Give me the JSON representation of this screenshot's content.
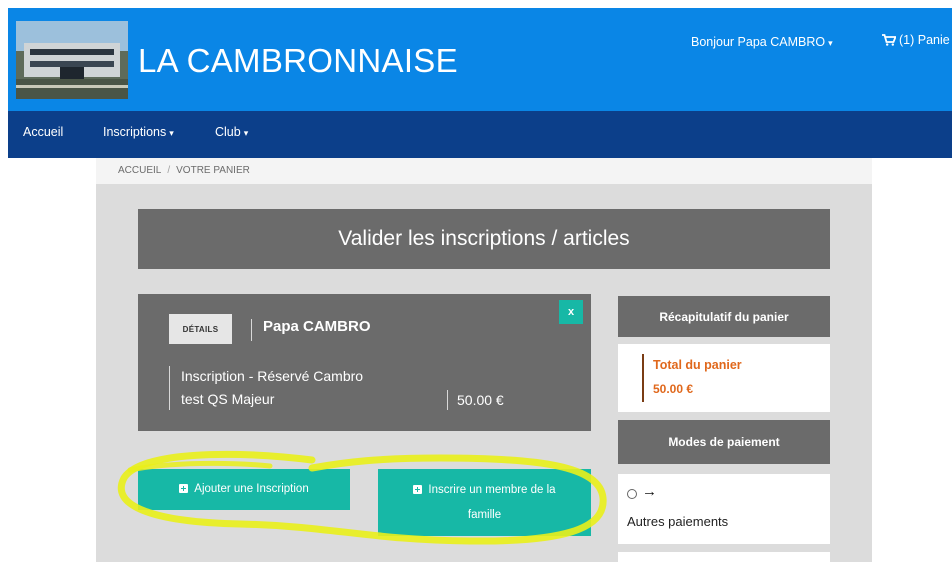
{
  "header": {
    "site_title": "LA CAMBRONNAISE",
    "greeting": "Bonjour Papa CAMBRO",
    "cart_label": "(1) Panie",
    "color_primary": "#0a86e6",
    "color_nav": "#0c3f8a"
  },
  "nav": {
    "items": [
      {
        "label": "Accueil"
      },
      {
        "label": "Inscriptions"
      },
      {
        "label": "Club"
      }
    ]
  },
  "breadcrumb": {
    "home": "ACCUEIL",
    "separator": "/",
    "current": "VOTRE PANIER"
  },
  "main": {
    "banner_title": "Valider les inscriptions / articles",
    "item": {
      "details_label": "DÉTAILS",
      "member_name": "Papa CAMBRO",
      "remove_label": "x",
      "line1": "Inscription - Réservé Cambro",
      "line2": "test QS Majeur",
      "price": "50.00 €"
    },
    "buttons": {
      "add_inscription": "Ajouter une Inscription",
      "add_member_line1": "Inscrire un membre de la",
      "add_member_line2": "famille"
    },
    "accent_color": "#17b8a6",
    "highlight_color": "#e9ef1a"
  },
  "sidebar": {
    "summary_title": "Récapitulatif du panier",
    "total_label": "Total du panier",
    "total_value": "50.00 €",
    "payment_title": "Modes de paiement",
    "payment_option_arrow": "→",
    "payment_option_label": "Autres paiements",
    "total_color": "#e0681c"
  }
}
